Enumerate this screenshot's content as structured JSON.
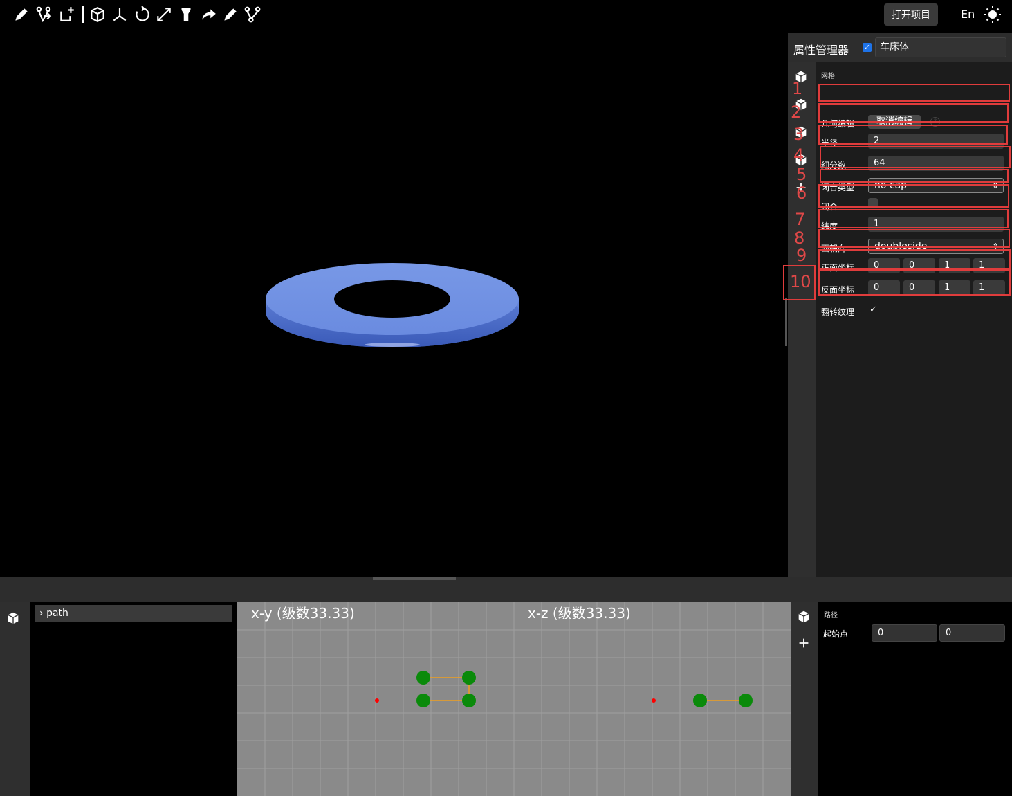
{
  "header": {
    "open_project": "打开项目",
    "language": "En"
  },
  "toolbar": {
    "tools": [
      "pencil-icon",
      "branch-icon",
      "add-node-icon",
      "cube-icon",
      "axes-icon",
      "rotate-icon",
      "scale-icon",
      "flashlight-icon",
      "redo-arrow-icon",
      "pencil-icon",
      "branch-icon"
    ]
  },
  "property_manager": {
    "title": "属性管理器",
    "visible_checked": true,
    "object_name": "车床体",
    "group_title": "网格",
    "rows": {
      "geometry_edit": {
        "label": "几何编辑",
        "button": "取消编辑",
        "help": "?"
      },
      "radius": {
        "label": "半径",
        "value": "2"
      },
      "segments": {
        "label": "细分数",
        "value": "64"
      },
      "cap_type": {
        "label": "闭合类型",
        "value": "no cap"
      },
      "closed": {
        "label": "闭合",
        "checked": false
      },
      "latitude": {
        "label": "纬度",
        "value": "1"
      },
      "face_side": {
        "label": "面朝向",
        "value": "doubleside"
      },
      "front_coords": {
        "label": "正面坐标",
        "values": [
          "0",
          "0",
          "1",
          "1"
        ]
      },
      "back_coords": {
        "label": "反面坐标",
        "values": [
          "0",
          "0",
          "1",
          "1"
        ]
      },
      "flip_texture": {
        "label": "翻转纹理",
        "checked": true,
        "mark": "✓"
      }
    },
    "annotations": [
      "1",
      "2",
      "3",
      "4",
      "5",
      "6",
      "7",
      "8",
      "9",
      "10"
    ]
  },
  "viewport": {
    "mesh_color": "#6f8fe0"
  },
  "bottom": {
    "tree_item": "path",
    "views": [
      {
        "label": "x-y (级数33.33)"
      },
      {
        "label": "x-z (级数33.33)"
      }
    ],
    "path_panel": {
      "title": "路径",
      "start_label": "起始点",
      "start_values": [
        "0",
        "0"
      ]
    }
  },
  "colors": {
    "accent": "#1e73e8",
    "annotation": "#e03c3c",
    "node": "#0a8a0a",
    "edge": "#f0a020",
    "origin": "#ff0000"
  }
}
